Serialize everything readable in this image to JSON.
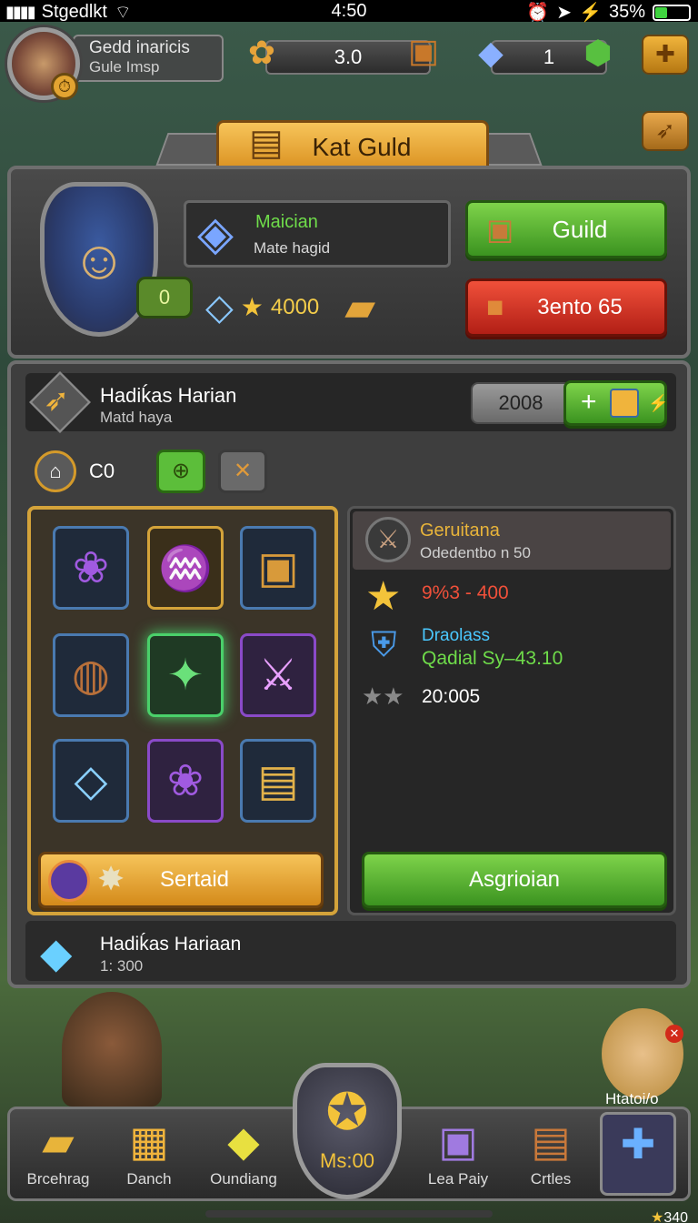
{
  "status_bar": {
    "carrier": "Stgedlkt",
    "time": "4:50",
    "battery": "35%",
    "battery_level": 0.35
  },
  "player": {
    "name": "Gedd inaricis",
    "subtitle": "Gule Imsp"
  },
  "resources": [
    {
      "icon": "sunflower-icon",
      "value": "3.0"
    },
    {
      "icon": "crystal-icon",
      "value": "1"
    }
  ],
  "title_banner": "Kat Guld",
  "guild": {
    "mage_title": "Maician",
    "mage_sub": "Mate hagid",
    "level": "0",
    "gold": "4000",
    "guild_button": "Guild",
    "red_button": "3ento 65"
  },
  "quest": {
    "title": "Hadiḱas Harian",
    "subtitle": "Matd haya",
    "counter": "2008"
  },
  "filter": {
    "count": "C0"
  },
  "items": [
    {
      "icon": "purple-bag-icon",
      "rarity": "rare"
    },
    {
      "icon": "purple-cloak-icon",
      "rarity": "legend"
    },
    {
      "icon": "treasure-chest-icon",
      "rarity": "rare"
    },
    {
      "icon": "wood-log-icon",
      "rarity": "rare"
    },
    {
      "icon": "green-crystal-icon",
      "rarity": "glow"
    },
    {
      "icon": "pink-crystal-sword-icon",
      "rarity": "epic"
    },
    {
      "icon": "blue-crystal-icon",
      "rarity": "rare"
    },
    {
      "icon": "purple-bag-icon",
      "rarity": "epic"
    },
    {
      "icon": "golden-chest-icon",
      "rarity": "rare"
    }
  ],
  "detail": {
    "name": "Geruitana",
    "sub": "Odedentbo n 50",
    "stat_red": "9%3 - 400",
    "dragon_title": "Draolass",
    "dragon_sub": "Qadial Sy–43.10",
    "star_stat": "20:005"
  },
  "buttons": {
    "sort": "Sertaid",
    "assign": "Asgrioian"
  },
  "quest2": {
    "title": "Hadiḱas Hariaan",
    "subtitle": "1: 300"
  },
  "hero_label": "Htatoi/o",
  "nav": [
    {
      "label": "Brcehrag",
      "icon": "gold-bar-icon"
    },
    {
      "label": "Danch",
      "icon": "gold-blocks-icon"
    },
    {
      "label": "Oundiang",
      "icon": "yellow-gems-icon"
    },
    {
      "label": "Ms:00",
      "icon": "crest-icon"
    },
    {
      "label": "Lea Paiy",
      "icon": "purple-box-icon"
    },
    {
      "label": "Crtles",
      "icon": "wood-chest-icon"
    },
    {
      "label": "",
      "icon": "blue-gift-icon"
    }
  ],
  "corner_stars": "340"
}
